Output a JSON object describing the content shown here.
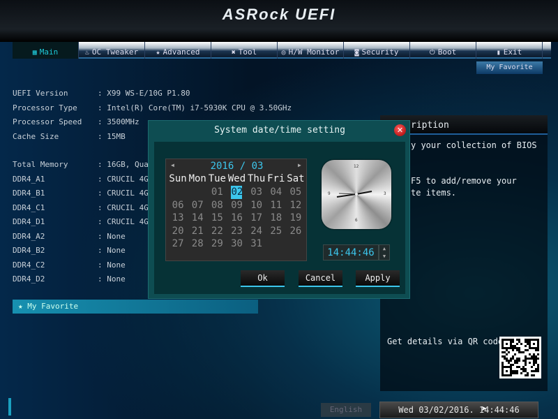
{
  "header": {
    "title": "ASRock UEFI"
  },
  "tabs": [
    {
      "label": "Main",
      "icon": "grid-icon"
    },
    {
      "label": "OC Tweaker",
      "icon": "flame-icon"
    },
    {
      "label": "Advanced",
      "icon": "star-icon"
    },
    {
      "label": "Tool",
      "icon": "wrench-icon"
    },
    {
      "label": "H/W Monitor",
      "icon": "monitor-icon"
    },
    {
      "label": "Security",
      "icon": "shield-icon"
    },
    {
      "label": "Boot",
      "icon": "power-icon"
    },
    {
      "label": "Exit",
      "icon": "exit-icon"
    }
  ],
  "my_favorite_button": "My Favorite",
  "info": [
    {
      "label": "UEFI Version",
      "value": ": X99 WS-E/10G P1.80"
    },
    {
      "label": "Processor Type",
      "value": ": Intel(R) Core(TM) i7-5930K CPU @ 3.50GHz"
    },
    {
      "label": "Processor Speed",
      "value": ": 3500MHz"
    },
    {
      "label": "Cache Size",
      "value": ": 15MB"
    },
    {
      "label": "Total Memory",
      "value": ": 16GB, Qua"
    },
    {
      "label": "DDR4_A1",
      "value": ": CRUCIL 4G"
    },
    {
      "label": "DDR4_B1",
      "value": ": CRUCIL 4G"
    },
    {
      "label": "DDR4_C1",
      "value": ": CRUCIL 4G"
    },
    {
      "label": "DDR4_D1",
      "value": ": CRUCIL 4G"
    },
    {
      "label": "DDR4_A2",
      "value": ": None"
    },
    {
      "label": "DDR4_B2",
      "value": ": None"
    },
    {
      "label": "DDR4_C2",
      "value": ": None"
    },
    {
      "label": "DDR4_D2",
      "value": ": None"
    }
  ],
  "favorite_item": "My Favorite",
  "description": {
    "title": "ription",
    "lines": [
      "y your collection of BIOS",
      "F5 to add/remove your",
      "te items."
    ],
    "qr_text": "Get details via QR code"
  },
  "dialog": {
    "title": "System date/time setting",
    "month": "2016 / 03",
    "weekdays": [
      "Sun",
      "Mon",
      "Tue",
      "Wed",
      "Thu",
      "Fri",
      "Sat"
    ],
    "dates": [
      "",
      "",
      "01",
      "02",
      "03",
      "04",
      "05",
      "06",
      "07",
      "08",
      "09",
      "10",
      "11",
      "12",
      "13",
      "14",
      "15",
      "16",
      "17",
      "18",
      "19",
      "20",
      "21",
      "22",
      "23",
      "24",
      "25",
      "26",
      "27",
      "28",
      "29",
      "30",
      "31"
    ],
    "selected_date": "02",
    "clock_numbers": [
      "12",
      "3",
      "6",
      "9"
    ],
    "time": "14:44:46",
    "ok": "Ok",
    "cancel": "Cancel",
    "apply": "Apply"
  },
  "footer": {
    "language": "English",
    "datetime": "Wed 03/02/2016. 14:44:46"
  },
  "colors": {
    "accent": "#3cc6ec",
    "dialog": "#0e4d52"
  }
}
